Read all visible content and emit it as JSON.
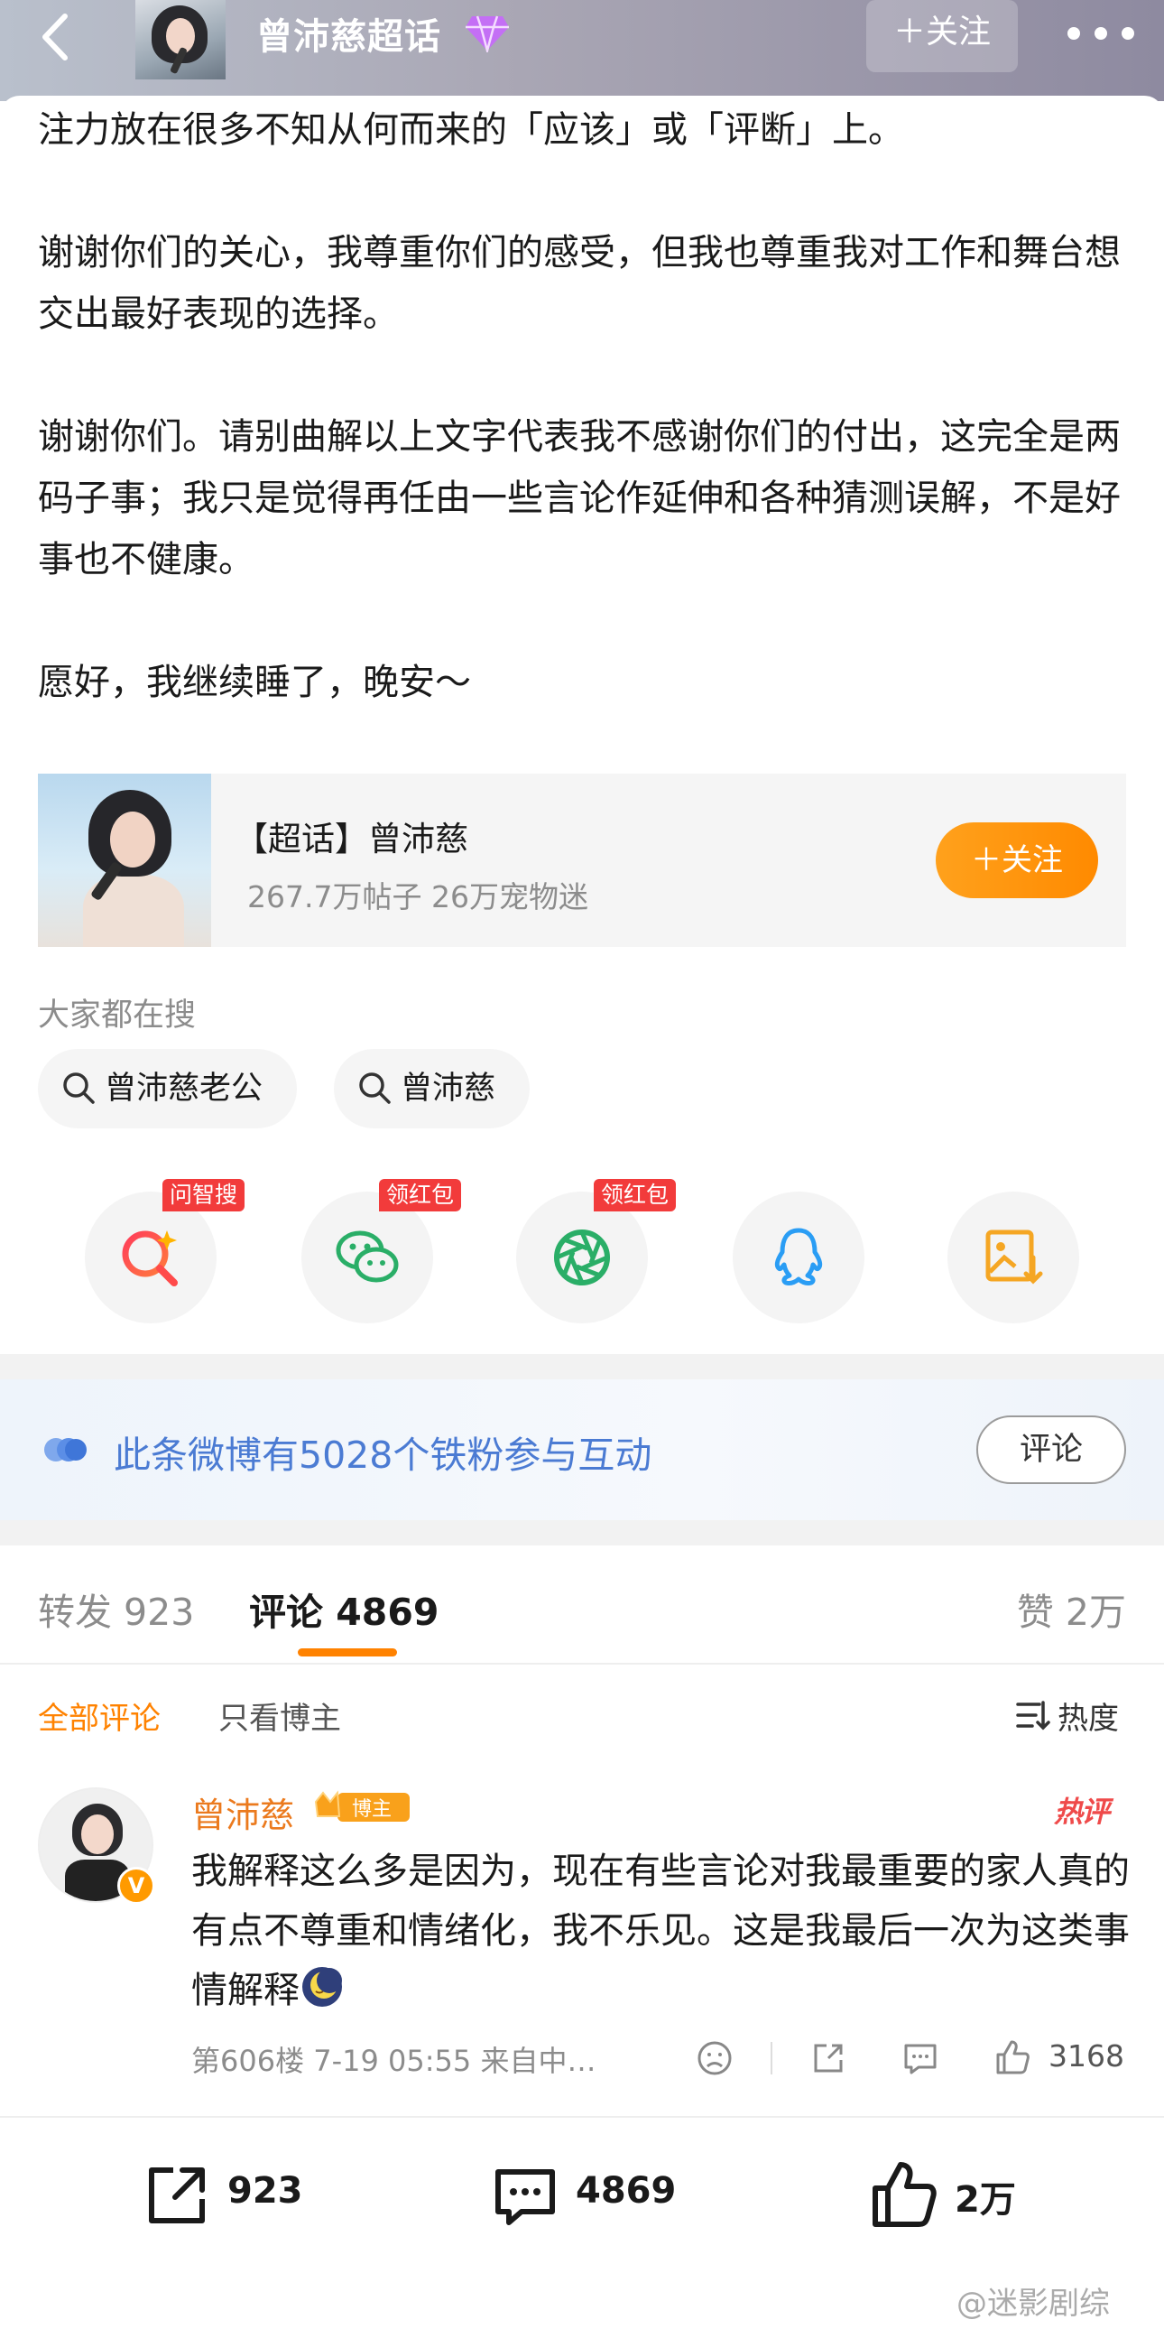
{
  "header": {
    "title": "曾沛慈超话",
    "follow_label": "＋关注",
    "gem_icon": "diamond-level-icon"
  },
  "post": {
    "paragraphs": [
      "注力放在很多不知从何而来的「应该」或「评断」上。",
      "谢谢你们的关心，我尊重你们的感受，但我也尊重我对工作和舞台想交出最好表现的选择。",
      "谢谢你们。请别曲解以上文字代表我不感谢你们的付出，这完全是两码子事；我只是觉得再任由一些言论作延伸和各种猜测误解，不是好事也不健康。",
      "愿好，我继续睡了，晚安～"
    ]
  },
  "topic_card": {
    "name": "【超话】曾沛慈",
    "stats": "267.7万帖子 26万宠物迷",
    "follow_label": "＋关注"
  },
  "searches": {
    "heading": "大家都在搜",
    "items": [
      "曾沛慈老公",
      "曾沛慈"
    ]
  },
  "share_row": {
    "items": [
      {
        "icon": "ai-search-icon",
        "badge": "问智搜"
      },
      {
        "icon": "wechat-icon",
        "badge": "领红包"
      },
      {
        "icon": "moments-icon",
        "badge": "领红包"
      },
      {
        "icon": "qq-icon",
        "badge": ""
      },
      {
        "icon": "save-image-icon",
        "badge": ""
      }
    ]
  },
  "fan_band": {
    "text": "此条微博有5028个铁粉参与互动",
    "button": "评论"
  },
  "tabs": {
    "repost": "转发 923",
    "comment": "评论 4869",
    "like": "赞 2万"
  },
  "filters": {
    "all": "全部评论",
    "poster_only": "只看博主",
    "sort": "热度"
  },
  "comment": {
    "author": "曾沛慈",
    "author_badge": "博主",
    "hot_badge": "热评",
    "text": "我解释这么多是因为，现在有些言论对我最重要的家人真的有点不尊重和情绪化，我不乐见。这是我最后一次为这类事情解释",
    "meta": "第606楼 7-19 05:55 来自中…",
    "likes": "3168"
  },
  "bottom_bar": {
    "repost": "923",
    "comment": "4869",
    "like": "2万"
  },
  "watermark": "@迷影剧综",
  "colors": {
    "accent_orange": "#ff8200",
    "link_blue": "#4b7bd3",
    "hot_red": "#ef4a4a"
  }
}
